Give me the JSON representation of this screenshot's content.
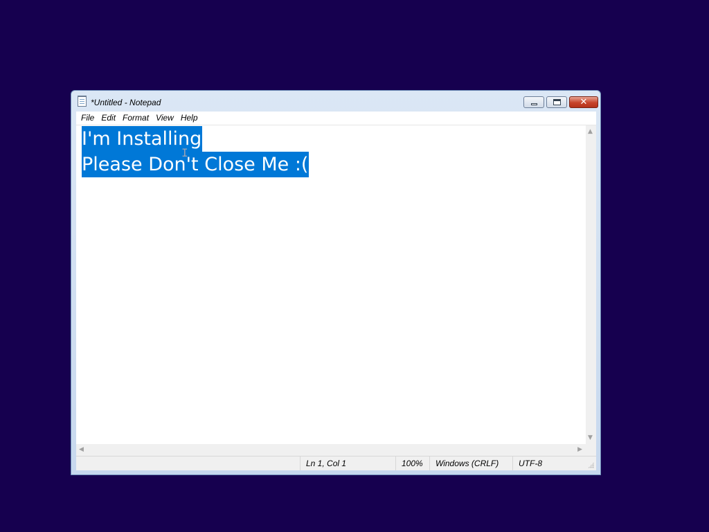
{
  "window": {
    "title": "*Untitled - Notepad",
    "close_glyph": "✕"
  },
  "menu": {
    "items": [
      "File",
      "Edit",
      "Format",
      "View",
      "Help"
    ]
  },
  "editor": {
    "lines": [
      "I'm Installing",
      "Please Don't Close Me :("
    ],
    "selection": "all",
    "selection_color": "#0078d7",
    "cursor_glyph": "I"
  },
  "scrollbars": {
    "up": "▲",
    "down": "▼",
    "left": "◀",
    "right": "▶"
  },
  "status": {
    "position": "Ln 1, Col 1",
    "zoom": "100%",
    "line_ending": "Windows (CRLF)",
    "encoding": "UTF-8"
  },
  "colors": {
    "desktop": "#16004f",
    "selection": "#0078d7",
    "close_button": "#c7432a"
  },
  "icons": [
    "notepad-app-icon",
    "minimize-icon",
    "maximize-icon",
    "close-icon",
    "scroll-up-icon",
    "scroll-down-icon",
    "scroll-left-icon",
    "scroll-right-icon",
    "size-grip-icon",
    "text-cursor-icon"
  ]
}
